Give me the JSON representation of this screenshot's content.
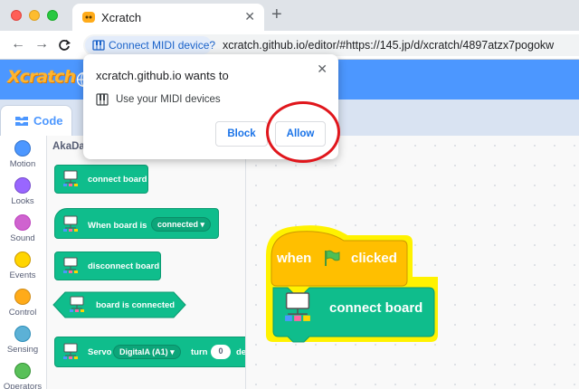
{
  "browser": {
    "tab_title": "Xcratch",
    "tab_close": "✕",
    "new_tab": "+",
    "nav": {
      "back": "←",
      "forward": "→",
      "reload": "C"
    },
    "permission_chip": "Connect MIDI device?",
    "url": "xcratch.github.io/editor/#https://145.jp/d/xcratch/4897atzx7pogokw"
  },
  "app": {
    "logo_text": "Xcratch",
    "code_tab_label": "Code"
  },
  "categories": [
    {
      "label": "Motion",
      "color": "#4c97ff"
    },
    {
      "label": "Looks",
      "color": "#9966ff"
    },
    {
      "label": "Sound",
      "color": "#cf63cf"
    },
    {
      "label": "Events",
      "color": "#ffd500"
    },
    {
      "label": "Control",
      "color": "#ffab19"
    },
    {
      "label": "Sensing",
      "color": "#5cb1d6"
    },
    {
      "label": "Operators",
      "color": "#59c059"
    }
  ],
  "flyout": {
    "title": "AkaDa",
    "blocks": {
      "connect_board": "connect board",
      "when_board_is": "When board is",
      "when_board_is_value": "connected",
      "disconnect_board": "disconnect board",
      "board_is_connected": "board is connected",
      "servo": "Servo",
      "servo_pin": "DigitalA (A1)",
      "servo_turn": "turn",
      "servo_degrees_value": "0",
      "servo_suffix": "de"
    }
  },
  "script": {
    "hat_when": "when",
    "hat_clicked": "clicked",
    "command": "connect board"
  },
  "popup": {
    "title": "xcratch.github.io wants to",
    "description": "Use your MIDI devices",
    "close": "✕",
    "block_label": "Block",
    "allow_label": "Allow"
  },
  "colors": {
    "scratch_blue": "#4c97ff",
    "extension_green": "#0fbd8c",
    "events_yellow": "#ffbf00",
    "highlight": "#fff200",
    "annotation_red": "#e0161c"
  }
}
